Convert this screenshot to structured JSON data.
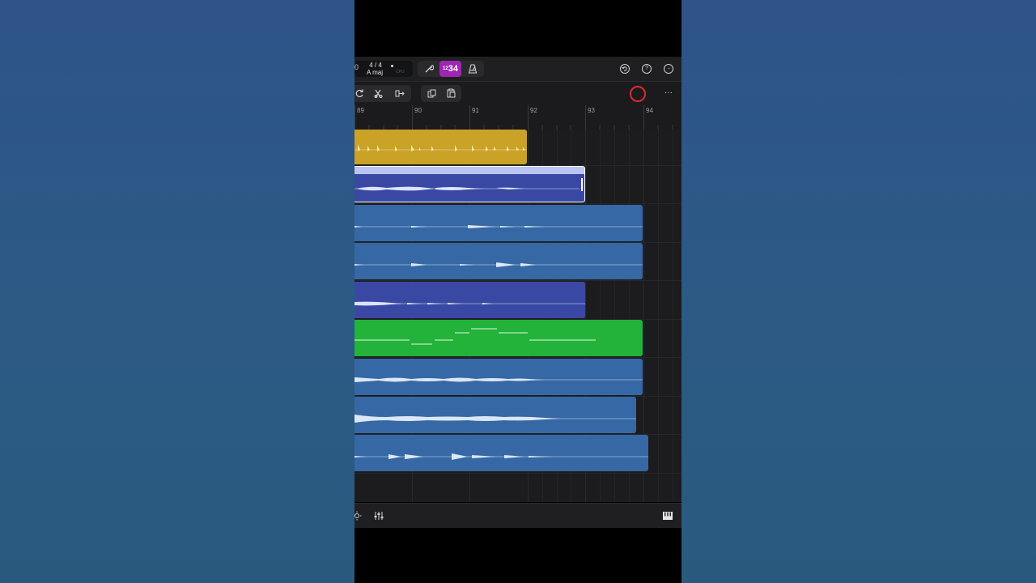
{
  "lcd": {
    "position_digit": "0",
    "time_signature": "4 / 4",
    "key": "A maj",
    "cpu_label": "CPU"
  },
  "toolbar": {
    "count_in_small": "12",
    "count_in_large": "34",
    "wrench_icon": "wrench-icon",
    "metronome_icon": "metronome-icon",
    "undo_icon": "undo-icon",
    "help_icon": "help-icon",
    "more_icon": "more-icon",
    "help_glyph": "?",
    "more_glyph": "···"
  },
  "edit_toolbar": {
    "loop_icon": "loop-icon",
    "split_icon": "split-icon",
    "join_icon": "join-icon",
    "copy_icon": "copy-icon",
    "paste_icon": "paste-icon",
    "record_color": "#e02b2b",
    "overflow_glyph": "···"
  },
  "ruler": {
    "bars": [
      "89",
      "90",
      "91",
      "92",
      "93",
      "94"
    ]
  },
  "regions": [
    {
      "name": "region-yellow",
      "type": "drummer",
      "color": "#c9a227"
    },
    {
      "name": "region-selected",
      "type": "audio",
      "color": "#3949a3",
      "selected": true
    },
    {
      "name": "region-blue-1",
      "type": "audio",
      "color": "#3568a4"
    },
    {
      "name": "region-blue-2",
      "type": "audio",
      "color": "#3568a4"
    },
    {
      "name": "region-indigo",
      "type": "audio",
      "color": "#3949a3"
    },
    {
      "name": "region-green",
      "type": "midi",
      "color": "#23b23a"
    },
    {
      "name": "region-blue-3",
      "type": "audio",
      "color": "#3568a4"
    },
    {
      "name": "region-blue-4",
      "type": "audio",
      "color": "#3568a4"
    },
    {
      "name": "region-blue-5",
      "type": "audio",
      "color": "#3568a4"
    }
  ],
  "bottom": {
    "brightness_icon": "brightness-icon",
    "mixer_icon": "mixer-icon",
    "piano_icon": "piano-keyboard-icon"
  }
}
